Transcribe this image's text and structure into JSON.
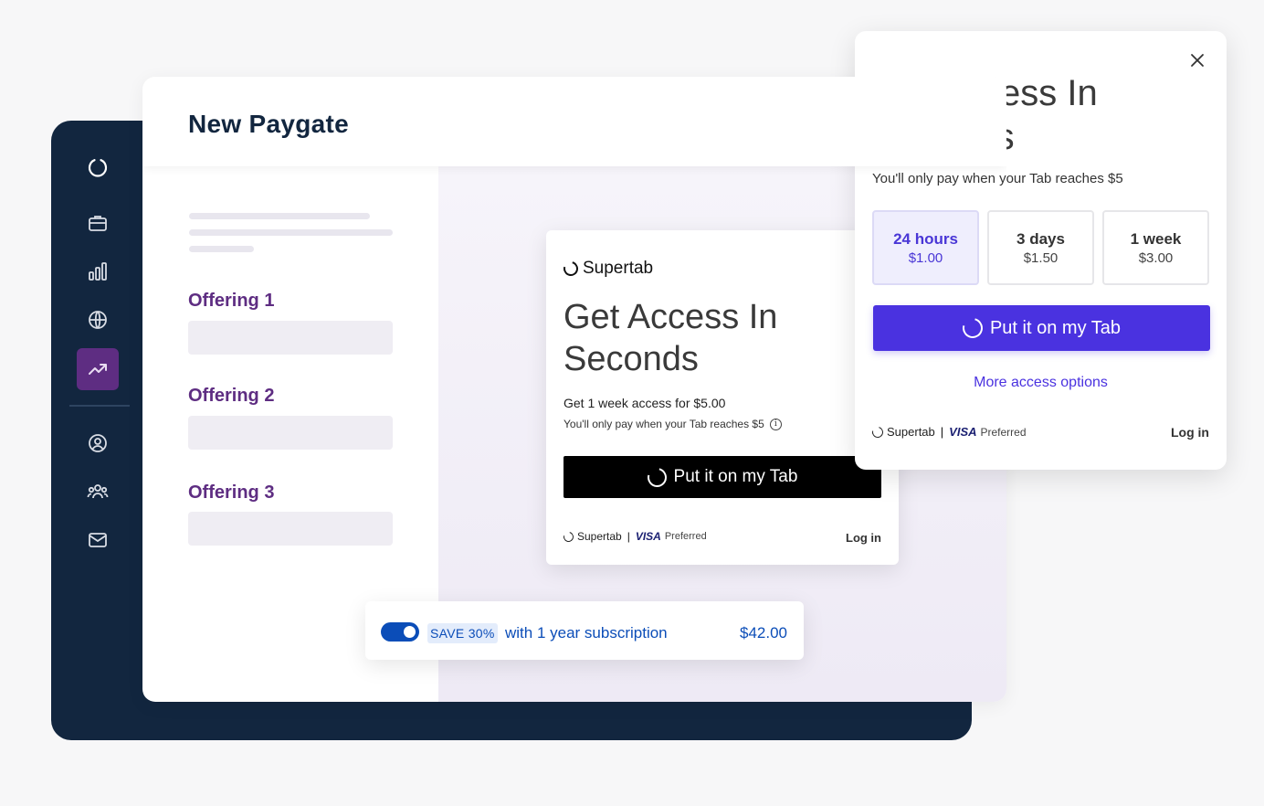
{
  "sidebar": {
    "icons": [
      {
        "name": "supertab-logo-icon"
      },
      {
        "name": "briefcase-icon"
      },
      {
        "name": "bar-chart-icon"
      },
      {
        "name": "globe-icon"
      },
      {
        "name": "trending-up-icon",
        "active": true
      },
      {
        "name": "user-circle-icon"
      },
      {
        "name": "users-group-icon"
      },
      {
        "name": "mail-icon"
      }
    ]
  },
  "header": {
    "title": "New Paygate"
  },
  "offerings": [
    {
      "label": "Offering 1"
    },
    {
      "label": "Offering 2"
    },
    {
      "label": "Offering 3"
    }
  ],
  "preview_card": {
    "brand": "Supertab",
    "headline": "Get Access In Seconds",
    "description": "Get 1 week access for $5.00",
    "note": "You'll only pay when your Tab reaches $5",
    "info_icon": "i",
    "button_label": "Put it on my Tab",
    "footer_brand": "Supertab",
    "footer_separator": "|",
    "visa": "VISA",
    "visa_suffix": "Preferred",
    "login": "Log in"
  },
  "subscription_bar": {
    "toggle_on": true,
    "badge": "SAVE 30%",
    "text": "with 1 year subscription",
    "price": "$42.00"
  },
  "modal": {
    "headline": "Get Access In Seconds",
    "subtitle": "You'll only pay when your Tab reaches $5",
    "plans": [
      {
        "name": "24 hours",
        "price": "$1.00",
        "selected": true
      },
      {
        "name": "3 days",
        "price": "$1.50",
        "selected": false
      },
      {
        "name": "1 week",
        "price": "$3.00",
        "selected": false
      }
    ],
    "button_label": "Put it on my Tab",
    "more_options": "More access options",
    "footer_brand": "Supertab",
    "footer_separator": "|",
    "visa": "VISA",
    "visa_suffix": "Preferred",
    "login": "Log in"
  },
  "colors": {
    "sidebar_bg": "#12263f",
    "accent_purple": "#5e2d82",
    "primary_blue": "#4a32e0",
    "link_blue": "#0b4db8"
  }
}
